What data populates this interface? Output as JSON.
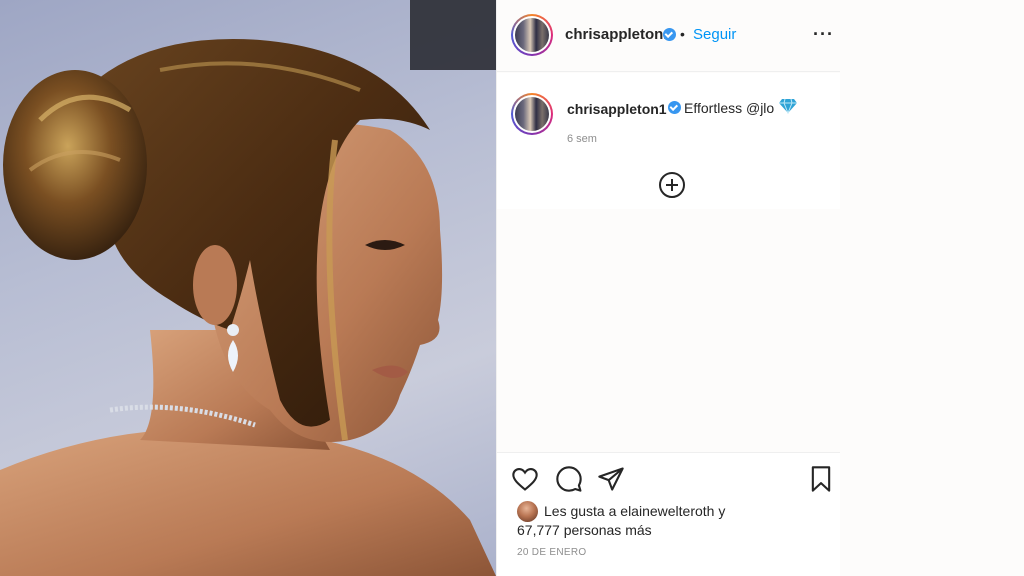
{
  "post": {
    "author": {
      "username": "chrisappleton1",
      "verified": true,
      "follow_label": "Seguir",
      "dot_separator": "•"
    },
    "more_label": "···",
    "caption": {
      "username": "chrisappleton1",
      "text": "Effortless @jlo",
      "emoji_icon": "gem-icon",
      "time_ago": "6 sem"
    },
    "actions": {
      "like_icon": "heart-icon",
      "comment_icon": "comment-icon",
      "share_icon": "paper-plane-icon",
      "save_icon": "bookmark-icon"
    },
    "likes": {
      "prefix": "Les gusta a",
      "user": "elainewelteroth",
      "conjunction": "y",
      "count": "67,777",
      "suffix": "personas más"
    },
    "date": "20 DE ENERO"
  },
  "colors": {
    "follow": "#0095f6",
    "verified": "#3897f0",
    "secondary_text": "#8e8e8e",
    "gem": "#2fa3d6"
  }
}
